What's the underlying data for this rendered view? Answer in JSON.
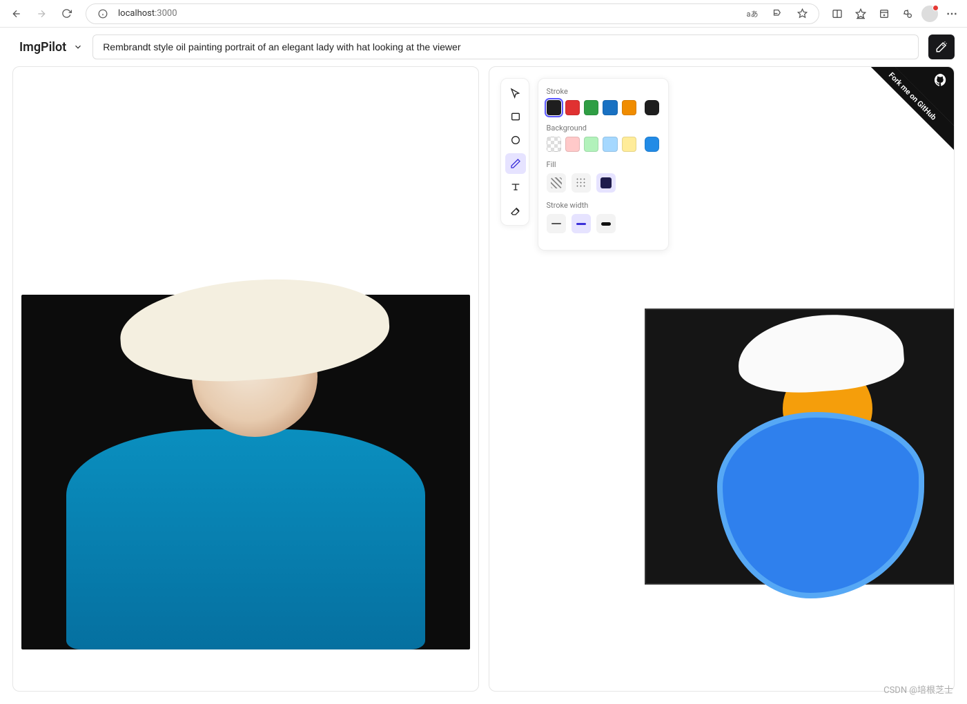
{
  "browser": {
    "url_host": "localhost",
    "url_port": ":3000",
    "translate_label": "aあ"
  },
  "app": {
    "brand": "ImgPilot",
    "prompt": "Rembrandt style oil painting portrait of an elegant lady with hat looking at the viewer"
  },
  "tools": {
    "selection": "Selection",
    "rectangle": "Rectangle",
    "ellipse": "Ellipse",
    "draw": "Draw",
    "text": "Text",
    "eraser": "Eraser",
    "active": "draw"
  },
  "panel": {
    "stroke_label": "Stroke",
    "background_label": "Background",
    "fill_label": "Fill",
    "stroke_width_label": "Stroke width",
    "stroke_colors": [
      "#1e1e1e",
      "#e03131",
      "#2f9e44",
      "#1971c2",
      "#f08c00"
    ],
    "stroke_extra": "#1e1e1e",
    "stroke_selected_index": 0,
    "bg_colors": [
      "transparent",
      "#ffc9c9",
      "#b2f2bb",
      "#a5d8ff",
      "#ffec99"
    ],
    "bg_extra": "#228be6",
    "bg_selected_index": 5,
    "fill_options": [
      "hachure",
      "cross-hatch",
      "solid"
    ],
    "fill_selected_index": 2,
    "stroke_width_options": [
      "thin",
      "medium",
      "thick"
    ],
    "stroke_width_selected_index": 1
  },
  "ribbon": {
    "label": "Fork me on GitHub"
  },
  "watermark": "CSDN @培根芝士"
}
